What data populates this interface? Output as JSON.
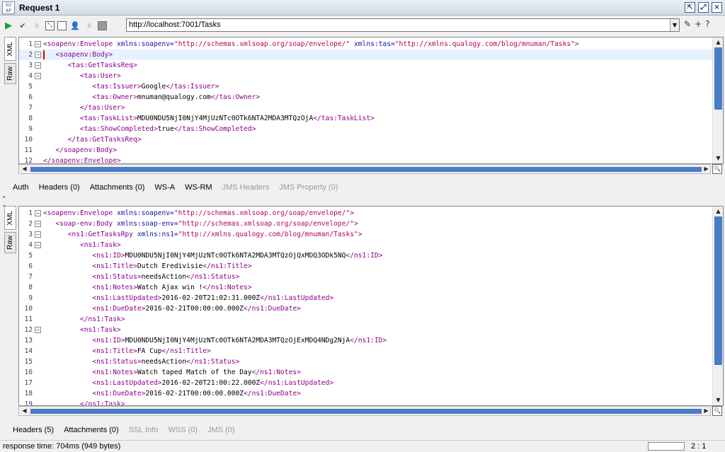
{
  "window": {
    "icon_label": "SO AP",
    "title": "Request 1"
  },
  "toolbar": {
    "url": "http://localhost:7001/Tasks",
    "icons": [
      "play-icon",
      "add-assertion-icon",
      "scale-icon",
      "fit-icon",
      "stop-icon",
      "user-icon",
      "gear-icon",
      "cancel-icon"
    ]
  },
  "side_tabs": {
    "xml": "XML",
    "raw": "Raw"
  },
  "request": {
    "lines": [
      [
        {
          "c": "tag",
          "t": "<soapenv:Envelope "
        },
        {
          "c": "attr",
          "t": "xmlns:soapenv="
        },
        {
          "c": "val",
          "t": "\"http://schemas.xmlsoap.org/soap/envelope/\" "
        },
        {
          "c": "attr",
          "t": "xmlns:tas="
        },
        {
          "c": "val",
          "t": "\"http://xmlns.qualogy.com/blog/mnuman/Tasks\""
        },
        {
          "c": "tag",
          "t": ">"
        }
      ],
      [
        {
          "c": "txt",
          "t": "   "
        },
        {
          "c": "tag",
          "t": "<soapenv:Body>"
        }
      ],
      [
        {
          "c": "txt",
          "t": "      "
        },
        {
          "c": "tag",
          "t": "<tas:GetTasksReq>"
        }
      ],
      [
        {
          "c": "txt",
          "t": "         "
        },
        {
          "c": "tag",
          "t": "<tas:User>"
        }
      ],
      [
        {
          "c": "txt",
          "t": "            "
        },
        {
          "c": "tag",
          "t": "<tas:Issuer>"
        },
        {
          "c": "txt",
          "t": "Google"
        },
        {
          "c": "tag",
          "t": "</tas:Issuer>"
        }
      ],
      [
        {
          "c": "txt",
          "t": "            "
        },
        {
          "c": "tag",
          "t": "<tas:Owner>"
        },
        {
          "c": "txt",
          "t": "mnuman@qualogy.com"
        },
        {
          "c": "tag",
          "t": "</tas:Owner>"
        }
      ],
      [
        {
          "c": "txt",
          "t": "         "
        },
        {
          "c": "tag",
          "t": "</tas:User>"
        }
      ],
      [
        {
          "c": "txt",
          "t": "         "
        },
        {
          "c": "tag",
          "t": "<tas:TaskList>"
        },
        {
          "c": "txt",
          "t": "MDU0NDU5NjI0NjY4MjUzNTc0OTk6NTA2MDA3MTQzOjA"
        },
        {
          "c": "tag",
          "t": "</tas:TaskList>"
        }
      ],
      [
        {
          "c": "txt",
          "t": "         "
        },
        {
          "c": "tag",
          "t": "<tas:ShowCompleted>"
        },
        {
          "c": "txt",
          "t": "true"
        },
        {
          "c": "tag",
          "t": "</tas:ShowCompleted>"
        }
      ],
      [
        {
          "c": "txt",
          "t": "      "
        },
        {
          "c": "tag",
          "t": "</tas:GetTasksReq>"
        }
      ],
      [
        {
          "c": "txt",
          "t": "   "
        },
        {
          "c": "tag",
          "t": "</soapenv:Body>"
        }
      ],
      [
        {
          "c": "tag",
          "t": "</soapenv:Envelope>"
        }
      ]
    ],
    "fold_lines": [
      1,
      2,
      3,
      4
    ],
    "highlight_line": 2
  },
  "request_tabs": [
    {
      "label": "Auth",
      "enabled": true
    },
    {
      "label": "Headers (0)",
      "enabled": true
    },
    {
      "label": "Attachments (0)",
      "enabled": true
    },
    {
      "label": "WS-A",
      "enabled": true
    },
    {
      "label": "WS-RM",
      "enabled": true
    },
    {
      "label": "JMS Headers",
      "enabled": false
    },
    {
      "label": "JMS Property (0)",
      "enabled": false
    }
  ],
  "response": {
    "lines": [
      [
        {
          "c": "tag",
          "t": "<soapenv:Envelope "
        },
        {
          "c": "attr",
          "t": "xmlns:soapenv="
        },
        {
          "c": "val",
          "t": "\"http://schemas.xmlsoap.org/soap/envelope/\""
        },
        {
          "c": "tag",
          "t": ">"
        }
      ],
      [
        {
          "c": "txt",
          "t": "   "
        },
        {
          "c": "tag",
          "t": "<soap-env:Body "
        },
        {
          "c": "attr",
          "t": "xmlns:soap-env="
        },
        {
          "c": "val",
          "t": "\"http://schemas.xmlsoap.org/soap/envelope/\""
        },
        {
          "c": "tag",
          "t": ">"
        }
      ],
      [
        {
          "c": "txt",
          "t": "      "
        },
        {
          "c": "tag",
          "t": "<ns1:GetTasksRpy "
        },
        {
          "c": "attr",
          "t": "xmlns:ns1="
        },
        {
          "c": "val",
          "t": "\"http://xmlns.qualogy.com/blog/mnuman/Tasks\""
        },
        {
          "c": "tag",
          "t": ">"
        }
      ],
      [
        {
          "c": "txt",
          "t": "         "
        },
        {
          "c": "tag",
          "t": "<ns1:Task>"
        }
      ],
      [
        {
          "c": "txt",
          "t": "            "
        },
        {
          "c": "tag",
          "t": "<ns1:ID>"
        },
        {
          "c": "txt",
          "t": "MDU0NDU5NjI0NjY4MjUzNTc0OTk6NTA2MDA3MTQzOjQxMDQ3ODk5NQ"
        },
        {
          "c": "tag",
          "t": "</ns1:ID>"
        }
      ],
      [
        {
          "c": "txt",
          "t": "            "
        },
        {
          "c": "tag",
          "t": "<ns1:Title>"
        },
        {
          "c": "txt",
          "t": "Dutch Eredivisie"
        },
        {
          "c": "tag",
          "t": "</ns1:Title>"
        }
      ],
      [
        {
          "c": "txt",
          "t": "            "
        },
        {
          "c": "tag",
          "t": "<ns1:Status>"
        },
        {
          "c": "txt",
          "t": "needsAction"
        },
        {
          "c": "tag",
          "t": "</ns1:Status>"
        }
      ],
      [
        {
          "c": "txt",
          "t": "            "
        },
        {
          "c": "tag",
          "t": "<ns1:Notes>"
        },
        {
          "c": "txt",
          "t": "Watch Ajax win !"
        },
        {
          "c": "tag",
          "t": "</ns1:Notes>"
        }
      ],
      [
        {
          "c": "txt",
          "t": "            "
        },
        {
          "c": "tag",
          "t": "<ns1:LastUpdated>"
        },
        {
          "c": "txt",
          "t": "2016-02-20T21:02:31.000Z"
        },
        {
          "c": "tag",
          "t": "</ns1:LastUpdated>"
        }
      ],
      [
        {
          "c": "txt",
          "t": "            "
        },
        {
          "c": "tag",
          "t": "<ns1:DueDate>"
        },
        {
          "c": "txt",
          "t": "2016-02-21T00:00:00.000Z"
        },
        {
          "c": "tag",
          "t": "</ns1:DueDate>"
        }
      ],
      [
        {
          "c": "txt",
          "t": "         "
        },
        {
          "c": "tag",
          "t": "</ns1:Task>"
        }
      ],
      [
        {
          "c": "txt",
          "t": "         "
        },
        {
          "c": "tag",
          "t": "<ns1:Task>"
        }
      ],
      [
        {
          "c": "txt",
          "t": "            "
        },
        {
          "c": "tag",
          "t": "<ns1:ID>"
        },
        {
          "c": "txt",
          "t": "MDU0NDU5NjI0NjY4MjUzNTc0OTk6NTA2MDA3MTQzOjExMDQ4NDg2NjA"
        },
        {
          "c": "tag",
          "t": "</ns1:ID>"
        }
      ],
      [
        {
          "c": "txt",
          "t": "            "
        },
        {
          "c": "tag",
          "t": "<ns1:Title>"
        },
        {
          "c": "txt",
          "t": "FA Cup"
        },
        {
          "c": "tag",
          "t": "</ns1:Title>"
        }
      ],
      [
        {
          "c": "txt",
          "t": "            "
        },
        {
          "c": "tag",
          "t": "<ns1:Status>"
        },
        {
          "c": "txt",
          "t": "needsAction"
        },
        {
          "c": "tag",
          "t": "</ns1:Status>"
        }
      ],
      [
        {
          "c": "txt",
          "t": "            "
        },
        {
          "c": "tag",
          "t": "<ns1:Notes>"
        },
        {
          "c": "txt",
          "t": "Watch taped Match of the Day"
        },
        {
          "c": "tag",
          "t": "</ns1:Notes>"
        }
      ],
      [
        {
          "c": "txt",
          "t": "            "
        },
        {
          "c": "tag",
          "t": "<ns1:LastUpdated>"
        },
        {
          "c": "txt",
          "t": "2016-02-20T21:00:22.000Z"
        },
        {
          "c": "tag",
          "t": "</ns1:LastUpdated>"
        }
      ],
      [
        {
          "c": "txt",
          "t": "            "
        },
        {
          "c": "tag",
          "t": "<ns1:DueDate>"
        },
        {
          "c": "txt",
          "t": "2016-02-21T00:00:00.000Z"
        },
        {
          "c": "tag",
          "t": "</ns1:DueDate>"
        }
      ],
      [
        {
          "c": "txt",
          "t": "         "
        },
        {
          "c": "tag",
          "t": "</ns1:Task>"
        }
      ]
    ],
    "fold_lines": [
      1,
      2,
      3,
      4,
      12
    ]
  },
  "response_tabs": [
    {
      "label": "Headers (5)",
      "enabled": true
    },
    {
      "label": "Attachments (0)",
      "enabled": true
    },
    {
      "label": "SSL Info",
      "enabled": false
    },
    {
      "label": "WSS (0)",
      "enabled": false
    },
    {
      "label": "JMS (0)",
      "enabled": false
    }
  ],
  "status": {
    "response_time": "response time: 704ms (949 bytes)",
    "position": "2 : 1"
  }
}
